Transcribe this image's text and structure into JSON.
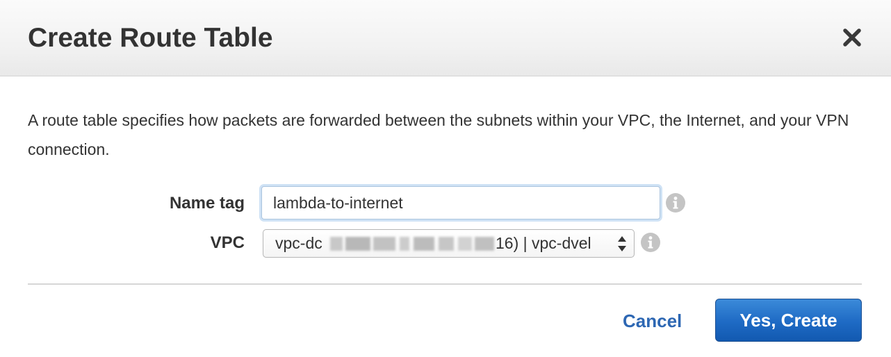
{
  "dialog": {
    "title": "Create Route Table",
    "close_icon": "close-icon",
    "description": "A route table specifies how packets are forwarded between the subnets within your VPC, the Internet, and your VPN connection."
  },
  "form": {
    "name_tag": {
      "label": "Name tag",
      "value": "lambda-to-internet",
      "info_icon": "info-icon"
    },
    "vpc": {
      "label": "VPC",
      "value_prefix": "vpc-dc",
      "value_suffix": "16) | vpc-dvel",
      "info_icon": "info-icon"
    }
  },
  "footer": {
    "cancel_label": "Cancel",
    "create_label": "Yes, Create"
  },
  "colors": {
    "primary_button": "#1e6ac4",
    "link": "#2d67b3",
    "text": "#333333"
  }
}
